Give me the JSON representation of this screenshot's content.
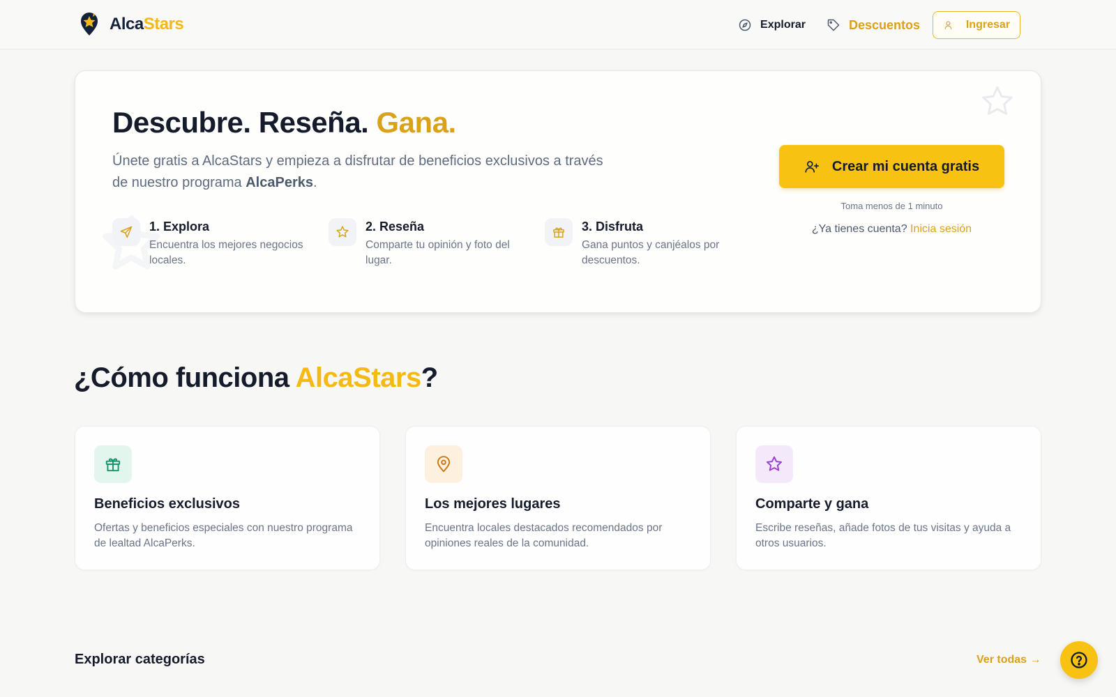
{
  "brand": {
    "name_part1": "Alca",
    "name_part2": "Stars"
  },
  "nav": {
    "explore": "Explorar",
    "discounts": "Descuentos",
    "login": "Ingresar"
  },
  "hero": {
    "title_main": "Descubre. Reseña. ",
    "title_accent": "Gana.",
    "subtitle_pre": "Únete gratis a AlcaStars y empieza a disfrutar de beneficios exclusivos a través de nuestro programa ",
    "subtitle_strong": "AlcaPerks",
    "subtitle_post": ".",
    "steps": [
      {
        "title": "1. Explora",
        "desc": "Encuentra los mejores negocios locales.",
        "icon": "send-icon"
      },
      {
        "title": "2. Reseña",
        "desc": "Comparte tu opinión y foto del lugar.",
        "icon": "star-icon"
      },
      {
        "title": "3. Disfruta",
        "desc": "Gana puntos y canjéalos por descuentos.",
        "icon": "gift-icon"
      }
    ],
    "cta_label": "Crear mi cuenta gratis",
    "cta_note": "Toma menos de 1 minuto",
    "have_account": "¿Ya tienes cuenta? ",
    "sign_in_link": "Inicia sesión"
  },
  "how": {
    "title_pre": "¿Cómo funciona ",
    "title_accent": "AlcaStars",
    "title_post": "?",
    "cards": [
      {
        "title": "Beneficios exclusivos",
        "desc": "Ofertas y beneficios especiales con nuestro programa de lealtad AlcaPerks.",
        "icon": "gift-icon",
        "bg": "#e3f6ee",
        "color": "#15956b"
      },
      {
        "title": "Los mejores lugares",
        "desc": "Encuentra locales destacados recomendados por opiniones reales de la comunidad.",
        "icon": "map-pin-icon",
        "bg": "#fdf0df",
        "color": "#c97a12"
      },
      {
        "title": "Comparte y gana",
        "desc": "Escribe reseñas, añade fotos de tus visitas y ayuda a otros usuarios.",
        "icon": "star-icon",
        "bg": "#f3e9fb",
        "color": "#9a3fd0"
      }
    ]
  },
  "categories": {
    "title": "Explorar categorías",
    "see_all": "Ver todas →"
  },
  "colors": {
    "accent": "#f8c212",
    "accent_text": "#d9a21a",
    "navy": "#14213d"
  }
}
